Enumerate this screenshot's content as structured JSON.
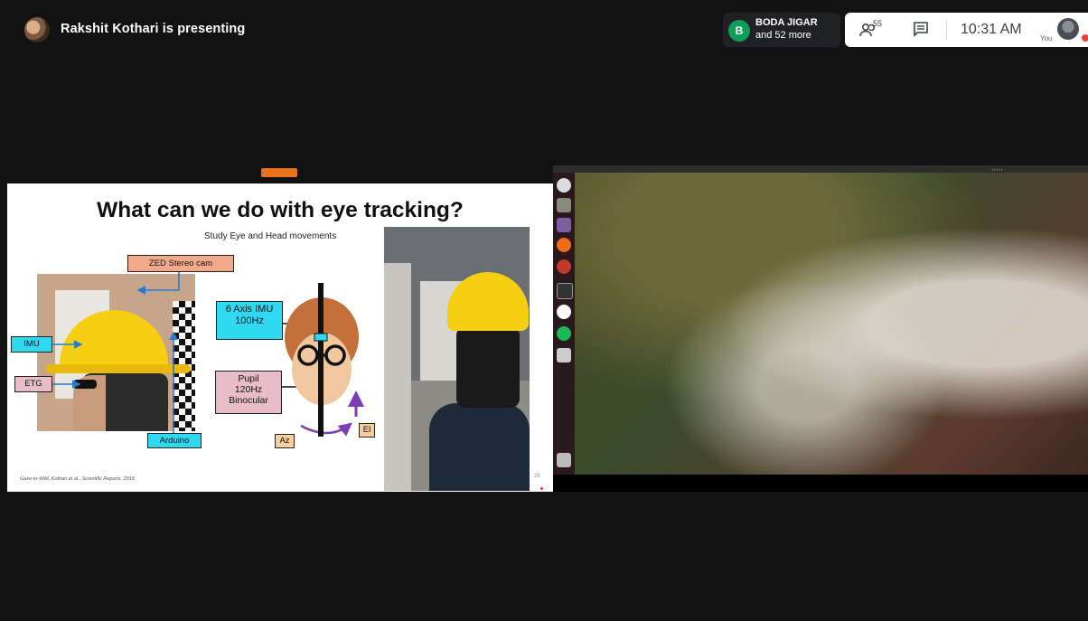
{
  "top_bar": {
    "presenter_label": "Rakshit Kothari is presenting",
    "participant_chip": {
      "initial": "B",
      "name": "BODA JIGAR",
      "more": "and 52 more"
    },
    "participant_count": "55",
    "time": "10:31 AM",
    "self_label": "You",
    "colors": {
      "chip_green": "#0f9d58",
      "record_red": "#ea4335"
    }
  },
  "slide": {
    "title": "What can we do with eye tracking?",
    "subtitle": "Study Eye and Head movements",
    "labels": {
      "zed": "ZED Stereo cam",
      "imu": "IMU",
      "etg": "ETG",
      "arduino": "Arduino",
      "axis_imu": "6 Axis IMU\n100Hz",
      "pupil": "Pupil\n120Hz\nBinocular",
      "az": "Az",
      "el": "El"
    },
    "credit": "Gaze-in-Wild, Kothari et al., Scientific Reports, 2019",
    "page_number": "28"
  },
  "desktop": {
    "launcher_icons": [
      "ubuntu-dash-icon",
      "files-icon",
      "app-icon",
      "firefox-icon",
      "settings-icon",
      "terminal-icon",
      "slack-icon",
      "spotify-icon",
      "drive-icon",
      "trash-icon"
    ]
  }
}
